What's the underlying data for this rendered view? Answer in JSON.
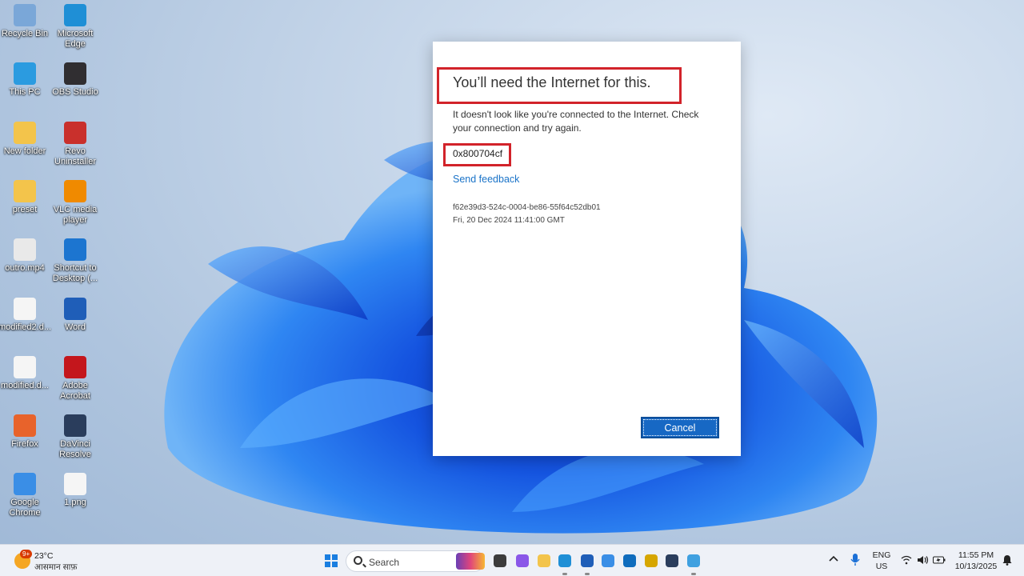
{
  "desktop": {
    "icons": [
      {
        "label": "Recycle Bin",
        "icon": "recycle-bin-icon",
        "color": "#7aa7d8"
      },
      {
        "label": "Microsoft Edge",
        "icon": "edge-icon",
        "color": "#1f8fd6"
      },
      {
        "label": "This PC",
        "icon": "monitor-icon",
        "color": "#2b9be0"
      },
      {
        "label": "OBS Studio",
        "icon": "obs-icon",
        "color": "#302e31"
      },
      {
        "label": "New folder",
        "icon": "folder-icon",
        "color": "#f3c44b"
      },
      {
        "label": "Revo Uninstaller",
        "icon": "revo-uninstaller-icon",
        "color": "#c9302c"
      },
      {
        "label": "preset",
        "icon": "folder-icon",
        "color": "#f3c44b"
      },
      {
        "label": "VLC media player",
        "icon": "vlc-icon",
        "color": "#f08a00"
      },
      {
        "label": "outro.mp4",
        "icon": "video-file-icon",
        "color": "#e9e9e9"
      },
      {
        "label": "Shortcut to Desktop (...",
        "icon": "onedrive-icon",
        "color": "#1c75d0"
      },
      {
        "label": "modified2.d...",
        "icon": "document-icon",
        "color": "#f5f5f5"
      },
      {
        "label": "Word",
        "icon": "word-icon",
        "color": "#1f5eb8"
      },
      {
        "label": "modified.d...",
        "icon": "document-icon",
        "color": "#f5f5f5"
      },
      {
        "label": "Adobe Acrobat",
        "icon": "acrobat-icon",
        "color": "#c4161c"
      },
      {
        "label": "Firefox",
        "icon": "firefox-icon",
        "color": "#e8632b"
      },
      {
        "label": "DaVinci Resolve",
        "icon": "davinci-icon",
        "color": "#2a3d5c"
      },
      {
        "label": "Google Chrome",
        "icon": "chrome-icon",
        "color": "#3a8ee6"
      },
      {
        "label": "1.png",
        "icon": "image-file-icon",
        "color": "#f5f5f5"
      }
    ]
  },
  "dialog": {
    "title": "You’ll need the Internet for this.",
    "message": "It doesn't look like you're connected to the Internet. Check your connection and try again.",
    "error_code": "0x800704cf",
    "feedback_link": "Send feedback",
    "correlation_id": "f62e39d3-524c-0004-be86-55f64c52db01",
    "timestamp": "Fri, 20 Dec 2024 11:41:00 GMT",
    "cancel_label": "Cancel",
    "highlight_color": "#d2232a"
  },
  "taskbar": {
    "weather": {
      "badge": "9+",
      "temp": "23°C",
      "desc": "आसमान साफ़"
    },
    "search_label": "Search",
    "apps": [
      {
        "name": "start-icon",
        "color": "#1a7ee0"
      },
      {
        "name": "task-view-icon",
        "color": "#3c3c3c"
      },
      {
        "name": "copilot-icon",
        "color": "#8a57e8"
      },
      {
        "name": "file-explorer-icon",
        "color": "#f3c44b"
      },
      {
        "name": "edge-icon",
        "color": "#1f8fd6"
      },
      {
        "name": "word-icon",
        "color": "#1f5eb8"
      },
      {
        "name": "chrome-icon",
        "color": "#3a8ee6"
      },
      {
        "name": "outlook-icon",
        "color": "#0f6cbd"
      },
      {
        "name": "sticky-notes-icon",
        "color": "#d6a600"
      },
      {
        "name": "davinci-icon",
        "color": "#2a3d5c"
      },
      {
        "name": "notepad-icon",
        "color": "#3fa0e0"
      }
    ],
    "tray": {
      "lang_line1": "ENG",
      "lang_line2": "US",
      "time": "11:55 PM",
      "date": "10/13/2025"
    }
  }
}
